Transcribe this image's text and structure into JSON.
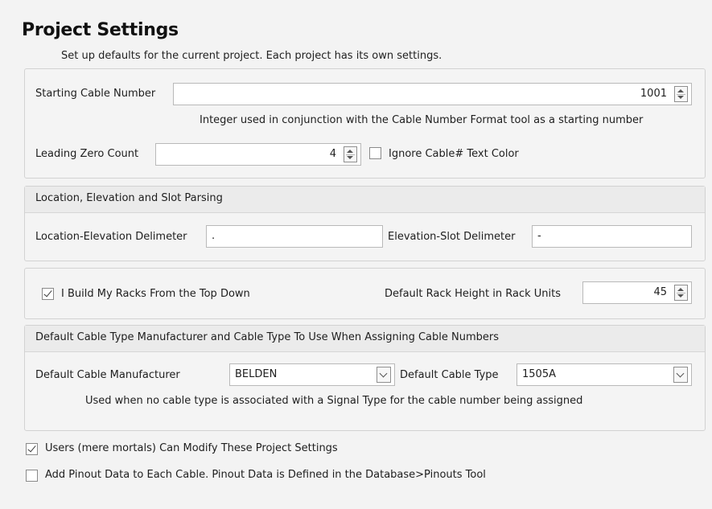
{
  "header": {
    "title": "Project Settings",
    "subtitle": "Set up defaults for the current project. Each project has its own settings."
  },
  "cable_number": {
    "starting_label": "Starting Cable Number",
    "starting_value": "1001",
    "help_text": "Integer used in conjunction with the Cable Number Format tool as a starting number",
    "leading_zero_label": "Leading Zero Count",
    "leading_zero_value": "4",
    "ignore_color_label": "Ignore Cable# Text Color",
    "ignore_color_checked": false
  },
  "parsing": {
    "header": "Location, Elevation and Slot Parsing",
    "loc_elev_label": "Location-Elevation Delimeter",
    "loc_elev_value": ".",
    "elev_slot_label": "Elevation-Slot Delimeter",
    "elev_slot_value": "-"
  },
  "racks": {
    "top_down_label": "I Build My Racks From the Top Down",
    "top_down_checked": true,
    "height_label": "Default Rack Height in Rack Units",
    "height_value": "45"
  },
  "cable_type": {
    "header": "Default Cable Type Manufacturer and Cable Type To Use When Assigning Cable Numbers",
    "manufacturer_label": "Default Cable Manufacturer",
    "manufacturer_value": "BELDEN",
    "type_label": "Default Cable Type",
    "type_value": "1505A",
    "help_text": "Used when no cable type is associated with a Signal Type for the cable number being assigned"
  },
  "options": {
    "users_modify_label": "Users (mere mortals) Can Modify These Project Settings",
    "users_modify_checked": true,
    "pinout_label": "Add Pinout Data to Each Cable. Pinout Data is Defined in the Database>Pinouts Tool",
    "pinout_checked": false
  }
}
